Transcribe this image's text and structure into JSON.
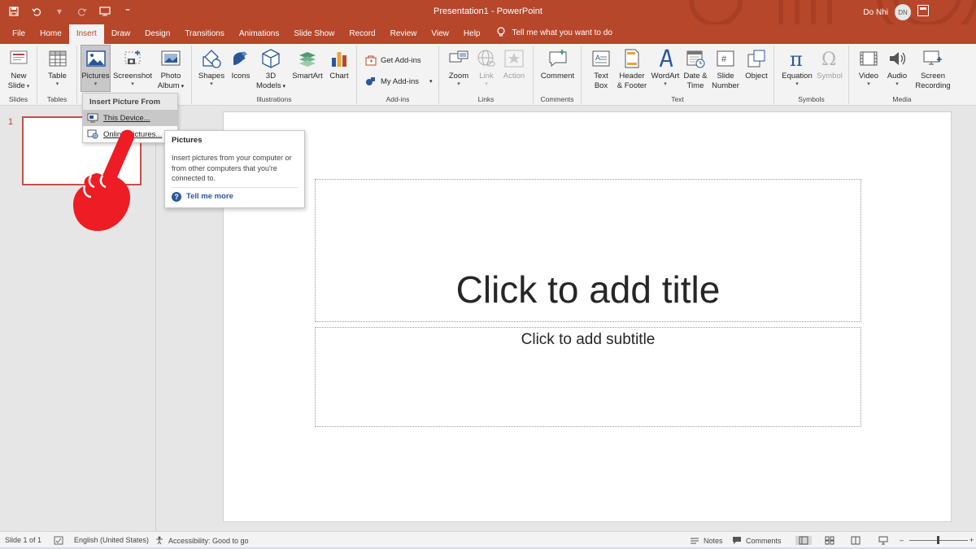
{
  "titlebar": {
    "title": "Presentation1  -  PowerPoint",
    "user_name": "Do Nhi",
    "user_initials": "DN",
    "qat_icons": [
      "save-icon",
      "undo-icon",
      "redo-icon",
      "present-from-beginning-icon",
      "customize-qat-icon"
    ]
  },
  "tabs": [
    {
      "label": "File"
    },
    {
      "label": "Home"
    },
    {
      "label": "Insert",
      "active": true
    },
    {
      "label": "Draw"
    },
    {
      "label": "Design"
    },
    {
      "label": "Transitions"
    },
    {
      "label": "Animations"
    },
    {
      "label": "Slide Show"
    },
    {
      "label": "Record"
    },
    {
      "label": "Review"
    },
    {
      "label": "View"
    },
    {
      "label": "Help"
    }
  ],
  "tellme": "Tell me what you want to do",
  "ribbon": {
    "groups": {
      "slides": "Slides",
      "tables": "Tables",
      "illustrations": "Illustrations",
      "addins": "Add-ins",
      "links": "Links",
      "comments": "Comments",
      "text": "Text",
      "symbols": "Symbols",
      "media": "Media"
    },
    "buttons": {
      "new_slide_1": "New",
      "new_slide_2": "Slide",
      "table": "Table",
      "pictures": "Pictures",
      "screenshot": "Screenshot",
      "photo_album_1": "Photo",
      "photo_album_2": "Album",
      "shapes": "Shapes",
      "icons": "Icons",
      "models_1": "3D",
      "models_2": "Models",
      "smartart": "SmartArt",
      "chart": "Chart",
      "get_addins": "Get Add-ins",
      "my_addins": "My Add-ins",
      "zoom": "Zoom",
      "link": "Link",
      "action": "Action",
      "comment": "Comment",
      "text_box_1": "Text",
      "text_box_2": "Box",
      "header_footer_1": "Header",
      "header_footer_2": "& Footer",
      "wordart": "WordArt",
      "date_time_1": "Date &",
      "date_time_2": "Time",
      "slide_number_1": "Slide",
      "slide_number_2": "Number",
      "object": "Object",
      "equation": "Equation",
      "symbol": "Symbol",
      "video": "Video",
      "audio": "Audio",
      "screen_recording_1": "Screen",
      "screen_recording_2": "Recording"
    }
  },
  "dropdown": {
    "header": "Insert Picture From",
    "items": [
      {
        "label": "This Device..."
      },
      {
        "label": "Online Pictures..."
      }
    ]
  },
  "tooltip": {
    "title": "Pictures",
    "body": "Insert pictures from your computer or from other computers that you're connected to.",
    "link": "Tell me more"
  },
  "slides_panel": {
    "slide_number": "1"
  },
  "slide": {
    "title_placeholder": "Click to add title",
    "subtitle_placeholder": "Click to add subtitle"
  },
  "status": {
    "slide_info": "Slide 1 of 1",
    "language": "English (United States)",
    "accessibility": "Accessibility: Good to go",
    "notes": "Notes",
    "comments": "Comments"
  },
  "colors": {
    "accent": "#b7472a",
    "ribbon_bg": "#f3f3f3",
    "link_blue": "#2b579a",
    "hand_red": "#ee1c24"
  }
}
